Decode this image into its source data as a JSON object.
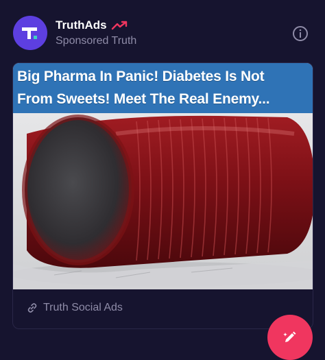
{
  "post": {
    "account_name": "TruthAds",
    "account_subtitle": "Sponsored Truth",
    "ad_headline": "Big Pharma In Panic! Diabetes Is Not\nFrom Sweets! Meet The Real Enemy...",
    "link_label": "Truth Social Ads"
  },
  "icons": {
    "avatar": "truth-social-logo",
    "trend": "trending-up-icon",
    "info": "info-icon",
    "link": "link-icon",
    "compose": "pencil-sparkle-icon"
  },
  "colors": {
    "background": "#16142f",
    "brand_purple": "#5d3fe0",
    "banner_blue": "#2f73b6",
    "accent_pink": "#f0365f",
    "muted_text": "#8f8ca8"
  }
}
